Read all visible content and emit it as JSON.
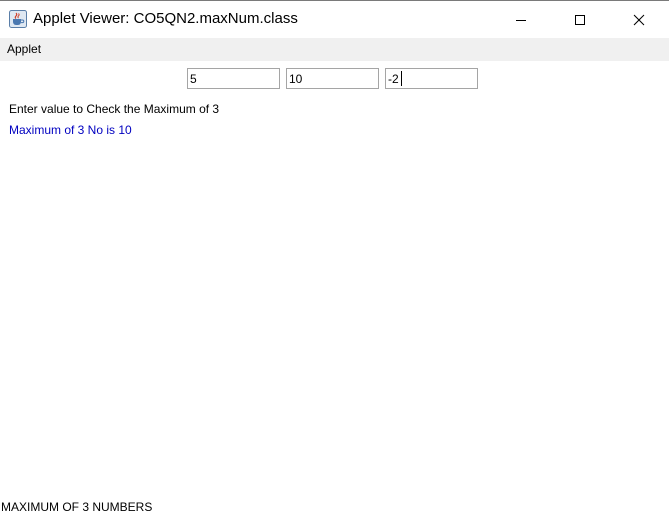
{
  "window": {
    "title": "Applet Viewer: CO5QN2.maxNum.class",
    "icon": "java-cup-icon"
  },
  "menubar": {
    "items": [
      {
        "label": "Applet"
      }
    ]
  },
  "applet": {
    "inputs": [
      {
        "value": "5"
      },
      {
        "value": "10"
      },
      {
        "value": "-2"
      }
    ],
    "prompt": "Enter value to Check the Maximum of 3",
    "result": "Maximum of 3 No is 10",
    "result_color": "#0000c0"
  },
  "status_bar": {
    "text": "MAXIMUM OF 3 NUMBERS"
  }
}
